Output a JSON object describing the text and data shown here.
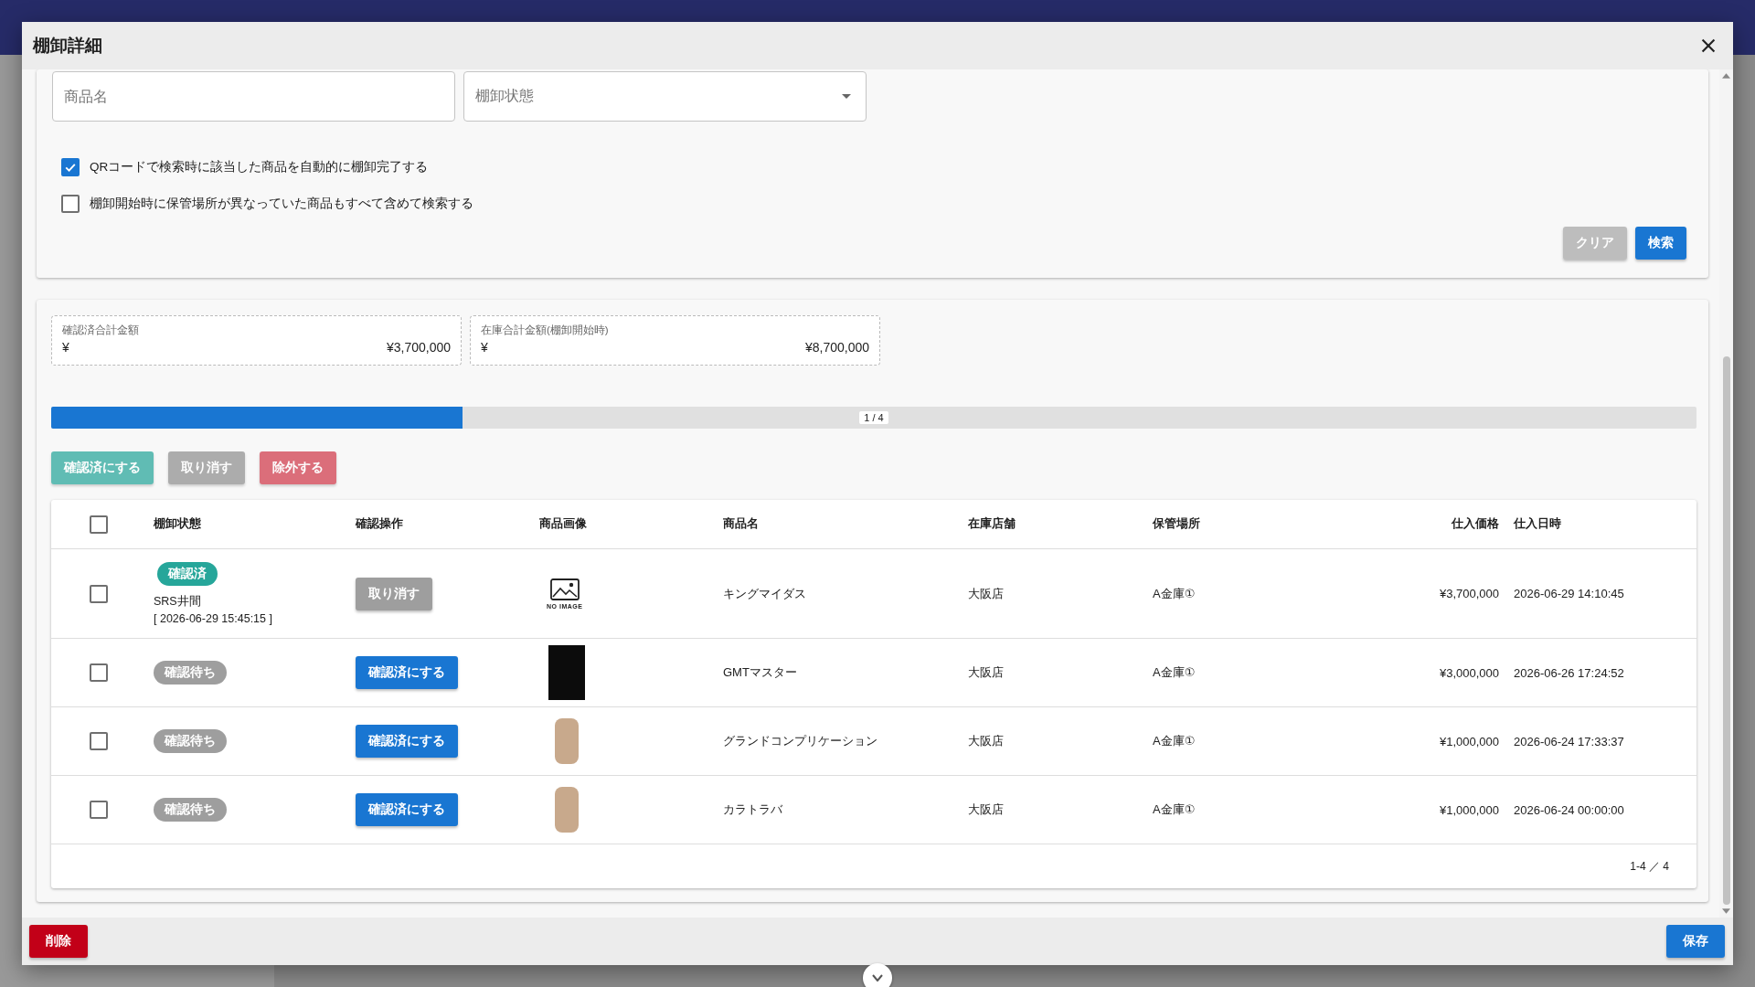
{
  "dialog": {
    "title": "棚卸詳細"
  },
  "search": {
    "fields": [
      {
        "kind": "text",
        "placeholder": "商品名"
      },
      {
        "kind": "select",
        "placeholder": "棚卸状態"
      }
    ],
    "options": [
      {
        "label": "QRコードで検索時に該当した商品を自動的に棚卸完了する",
        "checked": true
      },
      {
        "label": "棚卸開始時に保管場所が異なっていた商品もすべて含めて検索する",
        "checked": false
      }
    ],
    "buttons": [
      {
        "label": "クリア",
        "kind": "secondary"
      },
      {
        "label": "検索",
        "kind": "primary"
      }
    ]
  },
  "summary": [
    {
      "label": "確認済合計金額",
      "currency": "¥",
      "value": "¥3,700,000"
    },
    {
      "label": "在庫合計金額(棚卸開始時)",
      "currency": "¥",
      "value": "¥8,700,000"
    }
  ],
  "progress": {
    "level": 0.25,
    "text": "1 / 4"
  },
  "actions": [
    {
      "label": "確認済にする",
      "kind": "confirm",
      "disabled": true
    },
    {
      "label": "取り消す",
      "kind": "cancel",
      "disabled": true
    },
    {
      "label": "除外する",
      "kind": "exclude",
      "disabled": true
    }
  ],
  "table": {
    "select_all_checked": false,
    "columns": [
      "棚卸状態",
      "確認操作",
      "商品画像",
      "商品名",
      "在庫店舗",
      "保管場所",
      "仕入価格",
      "仕入日時"
    ],
    "rows": [
      {
        "checked": false,
        "status": {
          "label": "確認済",
          "kind": "done"
        },
        "confirmer": "SRS井間",
        "confirmed_at": "[ 2026-06-29 15:45:15 ]",
        "action": {
          "label": "取り消す",
          "kind": "cancel"
        },
        "image": {
          "kind": "none",
          "text": "NO IMAGE"
        },
        "name": "キングマイダス",
        "store": "大阪店",
        "location": "A金庫①",
        "price": "¥3,700,000",
        "purchased_at": "2026-06-29 14:10:45"
      },
      {
        "checked": false,
        "status": {
          "label": "確認待ち",
          "kind": "waiting"
        },
        "action": {
          "label": "確認済にする",
          "kind": "confirm"
        },
        "image": {
          "kind": "photo_dark"
        },
        "name": "GMTマスター",
        "store": "大阪店",
        "location": "A金庫①",
        "price": "¥3,000,000",
        "purchased_at": "2026-06-26 17:24:52"
      },
      {
        "checked": false,
        "status": {
          "label": "確認待ち",
          "kind": "waiting"
        },
        "action": {
          "label": "確認済にする",
          "kind": "confirm"
        },
        "image": {
          "kind": "photo"
        },
        "name": "グランドコンプリケーション",
        "store": "大阪店",
        "location": "A金庫①",
        "price": "¥1,000,000",
        "purchased_at": "2026-06-24 17:33:37"
      },
      {
        "checked": false,
        "status": {
          "label": "確認待ち",
          "kind": "waiting"
        },
        "action": {
          "label": "確認済にする",
          "kind": "confirm"
        },
        "image": {
          "kind": "photo"
        },
        "name": "カラトラバ",
        "store": "大阪店",
        "location": "A金庫①",
        "price": "¥1,000,000",
        "purchased_at": "2026-06-24 00:00:00"
      }
    ],
    "footer": "1-4 ／ 4"
  },
  "footer_buttons": [
    {
      "label": "削除",
      "kind": "danger"
    },
    {
      "label": "保存",
      "kind": "primary"
    }
  ]
}
